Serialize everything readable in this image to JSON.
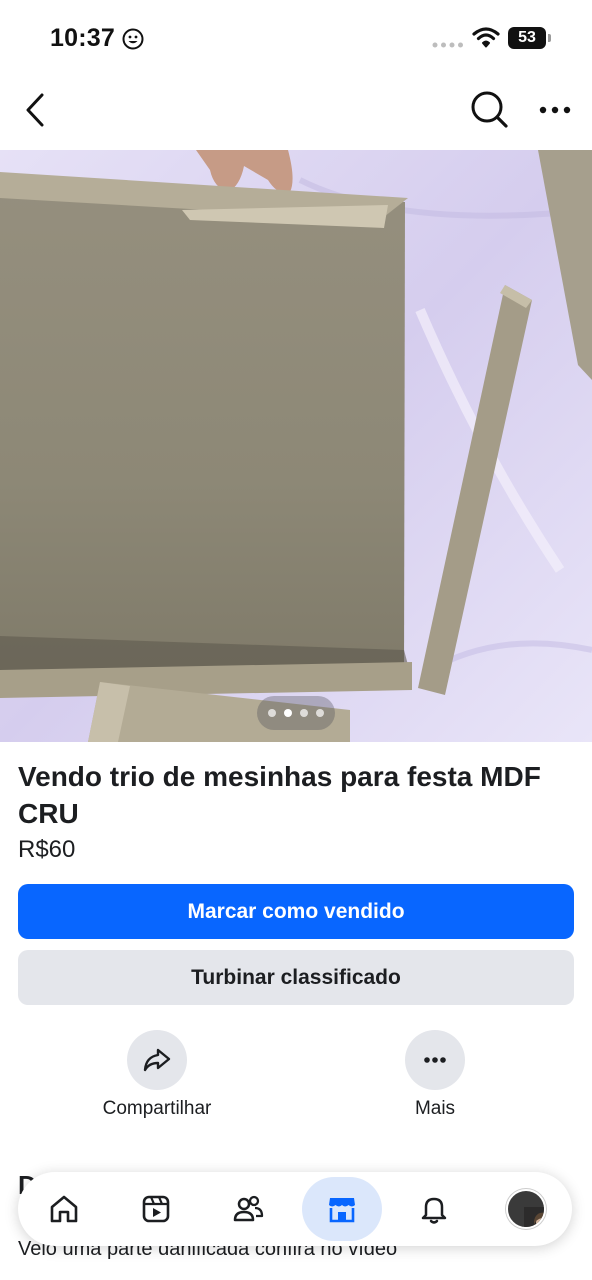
{
  "status_bar": {
    "time": "10:37",
    "battery": "53"
  },
  "nav": {
    "back_icon": "chevron-left-icon",
    "search_icon": "search-icon",
    "more_icon": "more-horizontal-icon"
  },
  "photo": {
    "pager_count": 4,
    "pager_active_index": 1
  },
  "listing": {
    "title": "Vendo trio de mesinhas para festa MDF CRU",
    "price": "R$60"
  },
  "buttons": {
    "mark_sold": "Marcar como vendido",
    "boost": "Turbinar classificado"
  },
  "actions": {
    "share_label": "Compartilhar",
    "more_label": "Mais"
  },
  "description": {
    "heading_partial": "D",
    "text_partial": "Veio uma parte danificada confira no vídeo"
  },
  "tab_bar": {
    "tabs": [
      "home-icon",
      "video-icon",
      "friends-icon",
      "marketplace-icon",
      "notifications-icon",
      "profile-avatar"
    ],
    "active_tab": "marketplace-icon"
  },
  "colors": {
    "primary": "#0866ff",
    "secondary_bg": "#e4e6eb",
    "active_tab_bg": "#dbe7fb",
    "text": "#1c1e21"
  }
}
